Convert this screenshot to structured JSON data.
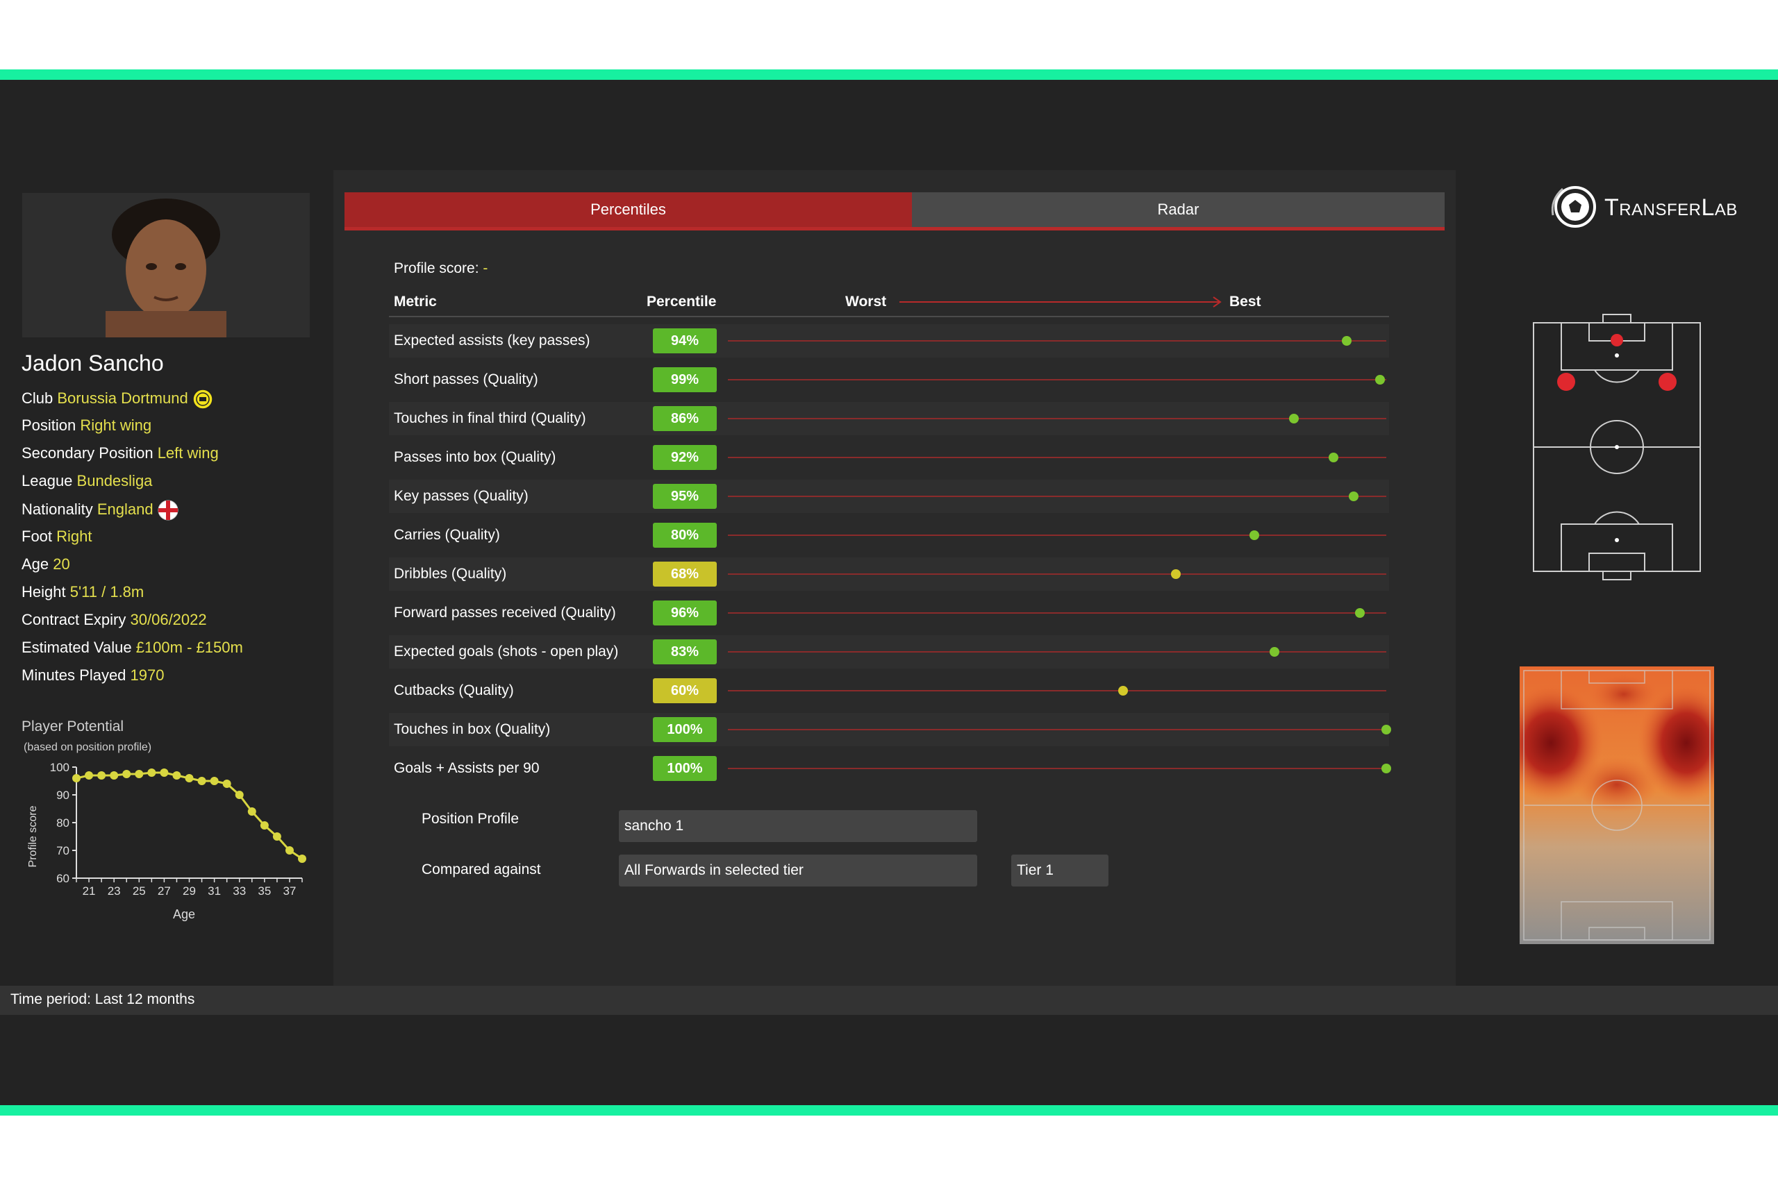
{
  "player": {
    "name": "Jadon Sancho",
    "fields": [
      {
        "label": "Club",
        "value": "Borussia Dortmund"
      },
      {
        "label": "Position",
        "value": "Right wing"
      },
      {
        "label": "Secondary Position",
        "value": "Left wing"
      },
      {
        "label": "League",
        "value": "Bundesliga"
      },
      {
        "label": "Nationality",
        "value": "England"
      },
      {
        "label": "Foot",
        "value": "Right"
      },
      {
        "label": "Age",
        "value": "20"
      },
      {
        "label": "Height",
        "value": "5'11 / 1.8m"
      },
      {
        "label": "Contract Expiry",
        "value": "30/06/2022"
      },
      {
        "label": "Estimated Value",
        "value": "£100m - £150m"
      },
      {
        "label": "Minutes Played",
        "value": "1970"
      }
    ]
  },
  "potential": {
    "title": "Player Potential",
    "subtitle": "(based on position profile)",
    "chart_data": {
      "type": "line",
      "xlabel": "Age",
      "ylabel": "Profile score",
      "x": [
        20,
        21,
        22,
        23,
        24,
        25,
        26,
        27,
        28,
        29,
        30,
        31,
        32,
        33,
        34,
        35,
        36,
        37,
        38
      ],
      "values": [
        96,
        97,
        97,
        97,
        97.5,
        97.5,
        98,
        98,
        97,
        96,
        95,
        95,
        94,
        90,
        84,
        79,
        75,
        70,
        67
      ],
      "ylim": [
        60,
        100
      ],
      "yticks": [
        60,
        70,
        80,
        90,
        100
      ],
      "xticks": [
        21,
        23,
        25,
        27,
        29,
        31,
        33,
        35,
        37
      ]
    }
  },
  "tabs": {
    "percentiles": "Percentiles",
    "radar": "Radar"
  },
  "profile_score": {
    "label": "Profile score:",
    "value": "-"
  },
  "headers": {
    "metric": "Metric",
    "percentile": "Percentile",
    "worst": "Worst",
    "best": "Best"
  },
  "metrics": [
    {
      "name": "Expected assists (key passes)",
      "pct": "94%",
      "value": 94
    },
    {
      "name": "Short passes (Quality)",
      "pct": "99%",
      "value": 99
    },
    {
      "name": "Touches in final third (Quality)",
      "pct": "86%",
      "value": 86
    },
    {
      "name": "Passes into box (Quality)",
      "pct": "92%",
      "value": 92
    },
    {
      "name": "Key passes (Quality)",
      "pct": "95%",
      "value": 95
    },
    {
      "name": "Carries (Quality)",
      "pct": "80%",
      "value": 80
    },
    {
      "name": "Dribbles (Quality)",
      "pct": "68%",
      "value": 68
    },
    {
      "name": "Forward passes received (Quality)",
      "pct": "96%",
      "value": 96
    },
    {
      "name": "Expected goals (shots - open play)",
      "pct": "83%",
      "value": 83
    },
    {
      "name": "Cutbacks (Quality)",
      "pct": "60%",
      "value": 60
    },
    {
      "name": "Touches in box (Quality)",
      "pct": "100%",
      "value": 100
    },
    {
      "name": "Goals + Assists per 90",
      "pct": "100%",
      "value": 100
    }
  ],
  "settings": {
    "position_profile_label": "Position Profile",
    "position_profile_value": "sancho 1",
    "compared_against_label": "Compared against",
    "compared_against_value": "All Forwards in selected tier",
    "tier_value": "Tier 1"
  },
  "logo_text": "TransferLab",
  "footer": {
    "time_period": "Time period: Last 12 months"
  },
  "colors": {
    "accent_red": "#a32525",
    "value_yellow": "#e5e04d",
    "stripe_green": "#17f0a0",
    "badge_green": "#5cb82a",
    "badge_yellow": "#c9c22a"
  }
}
